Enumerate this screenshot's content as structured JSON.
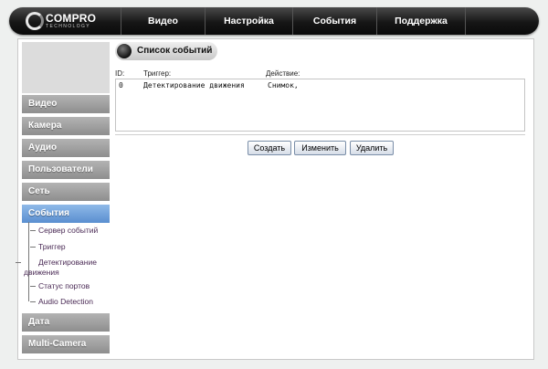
{
  "brand": {
    "name": "COMPRO",
    "sub": "TECHNOLOGY"
  },
  "nav": [
    "Видео",
    "Настройка",
    "События",
    "Поддержка"
  ],
  "sidebar": {
    "items": [
      {
        "label": "Видео"
      },
      {
        "label": "Камера"
      },
      {
        "label": "Аудио"
      },
      {
        "label": "Пользователи"
      },
      {
        "label": "Сеть"
      },
      {
        "label": "События",
        "active": true
      },
      {
        "label": "Дата"
      },
      {
        "label": "Multi-Camera"
      }
    ],
    "sub_items": [
      "Сервер событий",
      "Триггер",
      "Детектирование движения",
      "Статус портов",
      "Audio Detection"
    ]
  },
  "section": {
    "title": "Список событий",
    "columns": [
      "ID:",
      "Триггер:",
      "Действие:"
    ],
    "rows": [
      {
        "id": "0",
        "trigger": "Детектирование движения",
        "action": "Снимок,"
      }
    ]
  },
  "buttons": {
    "create": "Создать",
    "edit": "Изменить",
    "delete": "Удалить"
  },
  "colors": {
    "active_menu": "#6a9bd8",
    "menu": "#9e9e9e",
    "topbar": "#1a1a1a"
  }
}
